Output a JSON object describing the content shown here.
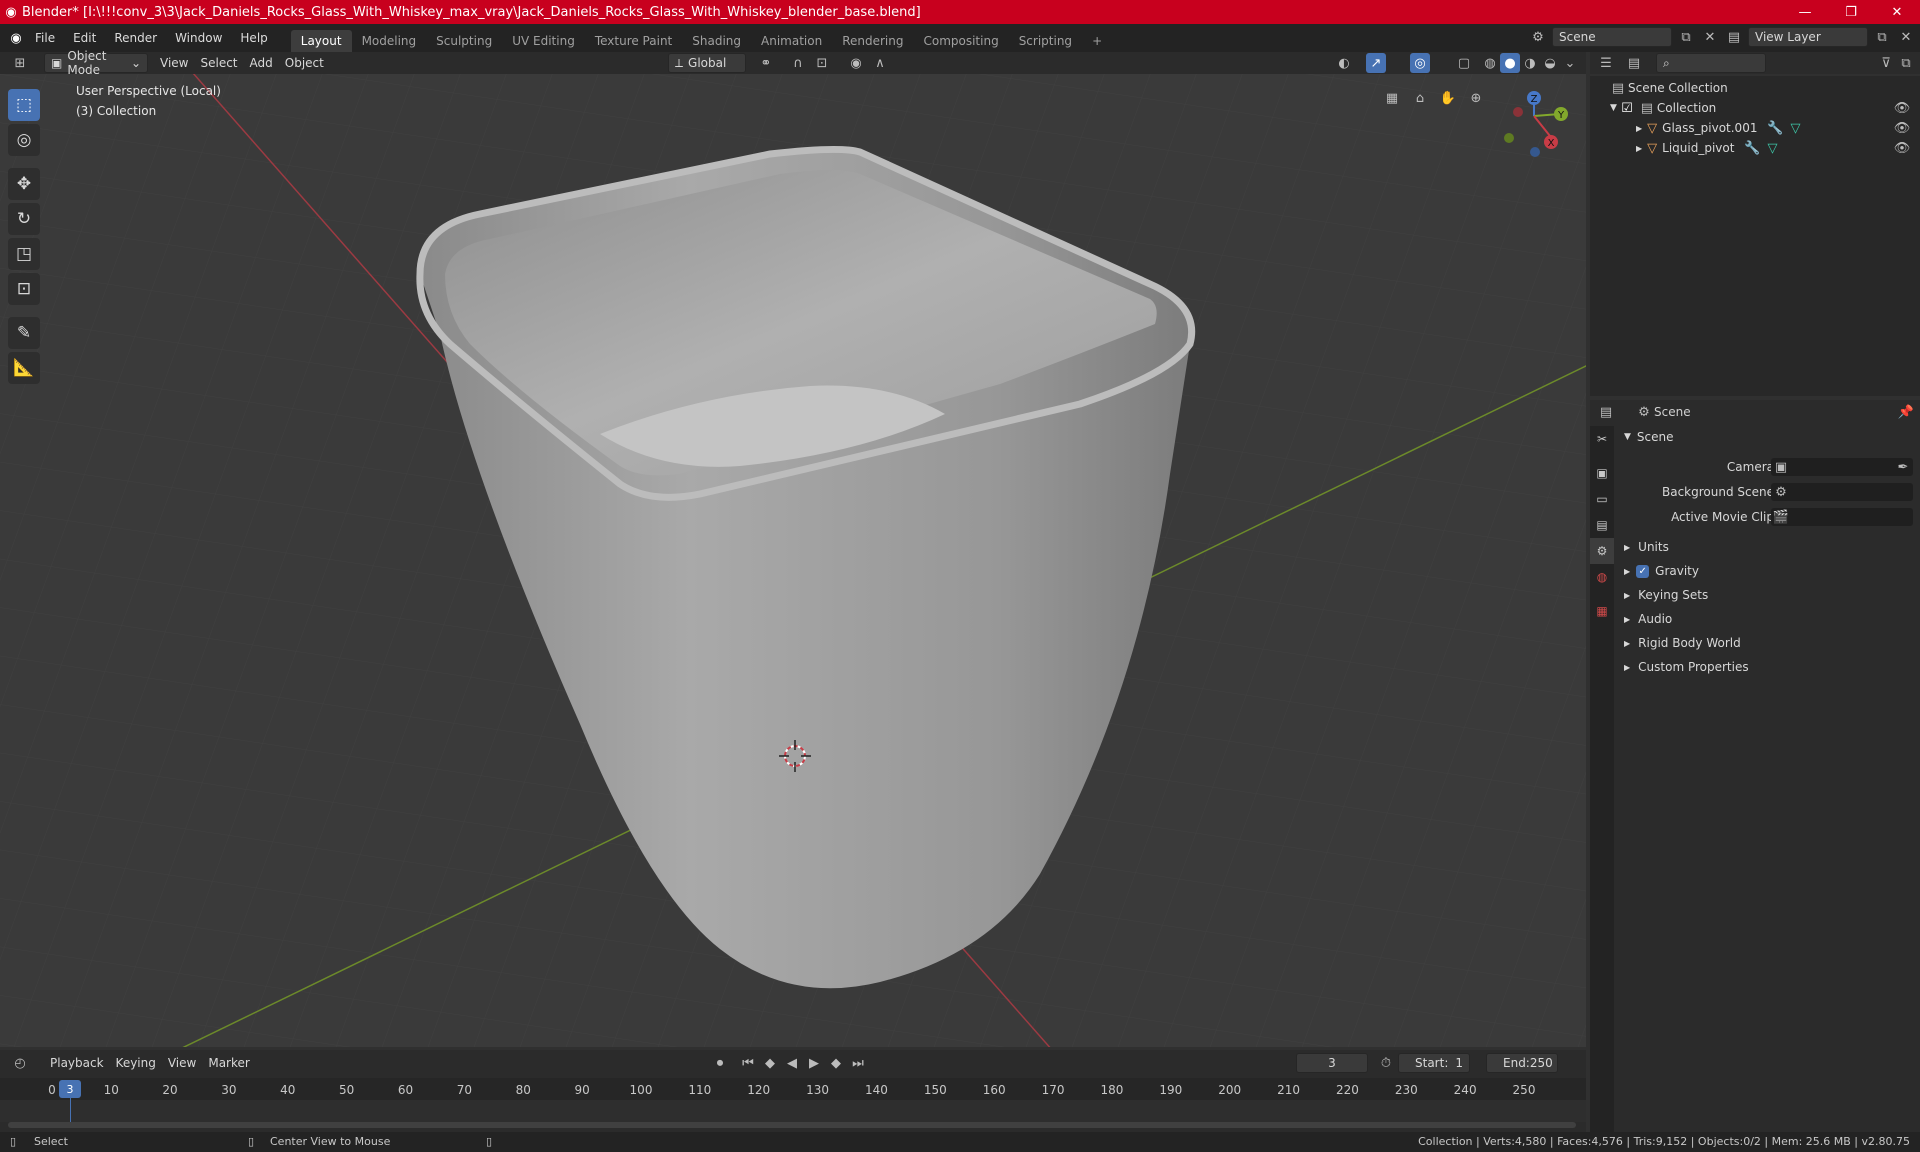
{
  "titlebar": {
    "text": "Blender* [I:\\!!!conv_3\\3\\Jack_Daniels_Rocks_Glass_With_Whiskey_max_vray\\Jack_Daniels_Rocks_Glass_With_Whiskey_blender_base.blend]",
    "minimize": "—",
    "maximize": "❐",
    "close": "✕"
  },
  "menu": [
    "File",
    "Edit",
    "Render",
    "Window",
    "Help"
  ],
  "workspaces": [
    "Layout",
    "Modeling",
    "Sculpting",
    "UV Editing",
    "Texture Paint",
    "Shading",
    "Animation",
    "Rendering",
    "Compositing",
    "Scripting"
  ],
  "add_workspace": "+",
  "scene_field": "Scene",
  "view_layer_field": "View Layer",
  "viewport_header": {
    "mode": "Object Mode",
    "menus": [
      "View",
      "Select",
      "Add",
      "Object"
    ],
    "transform": "Global"
  },
  "viewport": {
    "perspective": "User Perspective (Local)",
    "collection": "(3) Collection",
    "gizmo": {
      "x": "X",
      "y": "Y",
      "z": "Z"
    }
  },
  "outliner": {
    "root": "Scene Collection",
    "collection": "Collection",
    "items": [
      "Glass_pivot.001",
      "Liquid_pivot"
    ]
  },
  "properties": {
    "header": "Scene",
    "panel": "Scene",
    "camera_label": "Camera",
    "bg_scene_label": "Background Scene",
    "movie_clip_label": "Active Movie Clip",
    "sections": [
      "Units",
      "Gravity",
      "Keying Sets",
      "Audio",
      "Rigid Body World",
      "Custom Properties"
    ]
  },
  "timeline": {
    "menus": [
      "Playback",
      "Keying",
      "View",
      "Marker"
    ],
    "current_frame": "3",
    "start_label": "Start:",
    "start": "1",
    "end_label": "End:",
    "end": "250",
    "ticks": [
      "0",
      "10",
      "20",
      "30",
      "40",
      "50",
      "60",
      "70",
      "80",
      "90",
      "100",
      "110",
      "120",
      "130",
      "140",
      "150",
      "160",
      "170",
      "180",
      "190",
      "200",
      "210",
      "220",
      "230",
      "240",
      "250"
    ],
    "playhead": "3"
  },
  "statusbar": {
    "select": "Select",
    "center": "Center View to Mouse",
    "stats": "Collection | Verts:4,580 | Faces:4,576 | Tris:9,152 | Objects:0/2 | Mem: 25.6 MB | v2.80.75"
  },
  "colors": {
    "accent": "#4772b3",
    "titlebar": "#c8001e",
    "x_axis": "#c83c46",
    "y_axis": "#82a82c",
    "z_axis": "#4778c8"
  }
}
